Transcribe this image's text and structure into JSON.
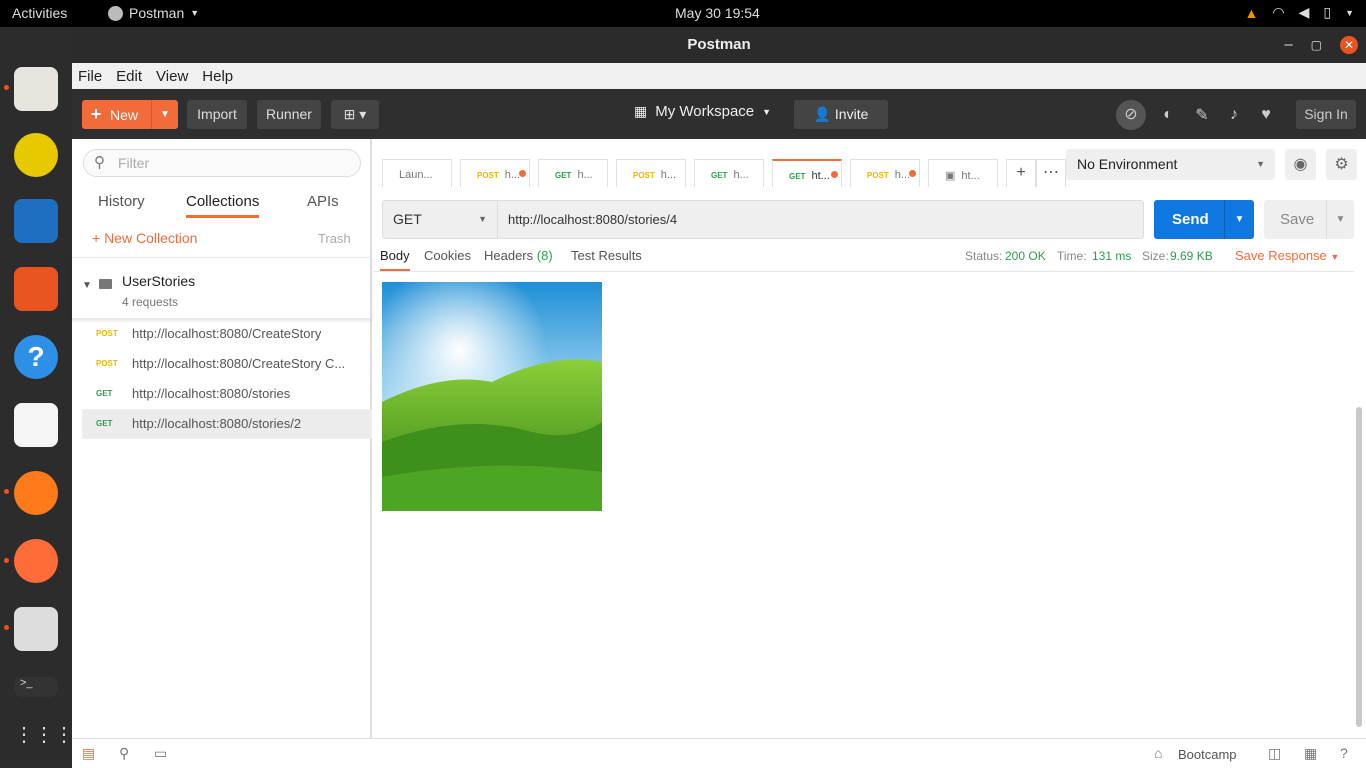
{
  "system": {
    "activities": "Activities",
    "app_name": "Postman",
    "clock": "May 30  19:54"
  },
  "window": {
    "title": "Postman"
  },
  "menu": [
    "File",
    "Edit",
    "View",
    "Help"
  ],
  "toolbar": {
    "new_label": "New",
    "import_label": "Import",
    "runner_label": "Runner",
    "workspace": "My Workspace",
    "invite_label": "Invite",
    "signin_label": "Sign In"
  },
  "sidebar": {
    "filter_placeholder": "Filter",
    "tabs": [
      "History",
      "Collections",
      "APIs"
    ],
    "new_collection": "+ New Collection",
    "trash": "Trash",
    "collection": {
      "name": "UserStories",
      "count": "4 requests"
    },
    "requests": [
      {
        "method": "POST",
        "url": "http://localhost:8080/CreateStory"
      },
      {
        "method": "POST",
        "url": "http://localhost:8080/CreateStory C..."
      },
      {
        "method": "GET",
        "url": "http://localhost:8080/stories"
      },
      {
        "method": "GET",
        "url": "http://localhost:8080/stories/2"
      }
    ]
  },
  "tabs": [
    {
      "method": "",
      "label": "Laun..."
    },
    {
      "method": "POST",
      "label": "h..."
    },
    {
      "method": "GET",
      "label": "h..."
    },
    {
      "method": "POST",
      "label": "h..."
    },
    {
      "method": "GET",
      "label": "h..."
    },
    {
      "method": "GET",
      "label": "ht..."
    },
    {
      "method": "POST",
      "label": "h..."
    },
    {
      "method": "",
      "label": "ht..."
    }
  ],
  "environment": "No Environment",
  "request": {
    "method": "GET",
    "url": "http://localhost:8080/stories/4",
    "send_label": "Send",
    "save_label": "Save"
  },
  "response": {
    "tabs": [
      "Body",
      "Cookies",
      "Headers",
      "Test Results"
    ],
    "headers_count": "(8)",
    "status_label": "Status:",
    "status": "200 OK",
    "time_label": "Time:",
    "time": "131 ms",
    "size_label": "Size:",
    "size": "9.69 KB",
    "save_response": "Save Response"
  },
  "statusbar": {
    "bootcamp": "Bootcamp"
  },
  "colors": {
    "accent": "#f26b3a",
    "send": "#0f77e0",
    "get": "#2e9d4e",
    "post": "#f0b400"
  }
}
